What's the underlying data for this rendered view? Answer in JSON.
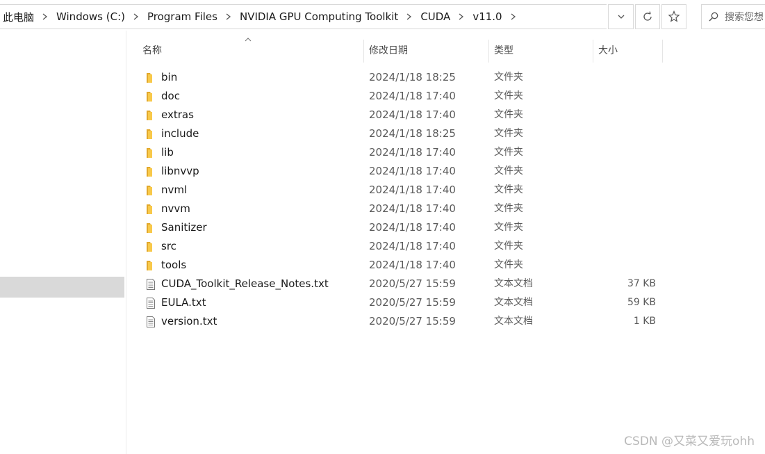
{
  "breadcrumb": [
    "此电脑",
    "Windows (C:)",
    "Program Files",
    "NVIDIA GPU Computing Toolkit",
    "CUDA",
    "v11.0"
  ],
  "search": {
    "placeholder": "搜索您想"
  },
  "columns": {
    "name": "名称",
    "date": "修改日期",
    "type": "类型",
    "size": "大小"
  },
  "files": [
    {
      "name": "bin",
      "date": "2024/1/18 18:25",
      "type": "文件夹",
      "size": "",
      "icon": "folder-icon"
    },
    {
      "name": "doc",
      "date": "2024/1/18 17:40",
      "type": "文件夹",
      "size": "",
      "icon": "folder-icon"
    },
    {
      "name": "extras",
      "date": "2024/1/18 17:40",
      "type": "文件夹",
      "size": "",
      "icon": "folder-icon"
    },
    {
      "name": "include",
      "date": "2024/1/18 18:25",
      "type": "文件夹",
      "size": "",
      "icon": "folder-icon"
    },
    {
      "name": "lib",
      "date": "2024/1/18 17:40",
      "type": "文件夹",
      "size": "",
      "icon": "folder-icon"
    },
    {
      "name": "libnvvp",
      "date": "2024/1/18 17:40",
      "type": "文件夹",
      "size": "",
      "icon": "folder-icon"
    },
    {
      "name": "nvml",
      "date": "2024/1/18 17:40",
      "type": "文件夹",
      "size": "",
      "icon": "folder-icon"
    },
    {
      "name": "nvvm",
      "date": "2024/1/18 17:40",
      "type": "文件夹",
      "size": "",
      "icon": "folder-icon"
    },
    {
      "name": "Sanitizer",
      "date": "2024/1/18 17:40",
      "type": "文件夹",
      "size": "",
      "icon": "folder-icon"
    },
    {
      "name": "src",
      "date": "2024/1/18 17:40",
      "type": "文件夹",
      "size": "",
      "icon": "folder-icon"
    },
    {
      "name": "tools",
      "date": "2024/1/18 17:40",
      "type": "文件夹",
      "size": "",
      "icon": "folder-icon"
    },
    {
      "name": "CUDA_Toolkit_Release_Notes.txt",
      "date": "2020/5/27 15:59",
      "type": "文本文档",
      "size": "37 KB",
      "icon": "text-file-icon"
    },
    {
      "name": "EULA.txt",
      "date": "2020/5/27 15:59",
      "type": "文本文档",
      "size": "59 KB",
      "icon": "text-file-icon"
    },
    {
      "name": "version.txt",
      "date": "2020/5/27 15:59",
      "type": "文本文档",
      "size": "1 KB",
      "icon": "text-file-icon"
    }
  ],
  "watermark": "CSDN @又菜又爱玩ohh",
  "colors": {
    "folder": "#f8c94a",
    "folder_dark": "#e2a82b",
    "selection": "#d9d9d9",
    "border": "#d9d9d9"
  }
}
